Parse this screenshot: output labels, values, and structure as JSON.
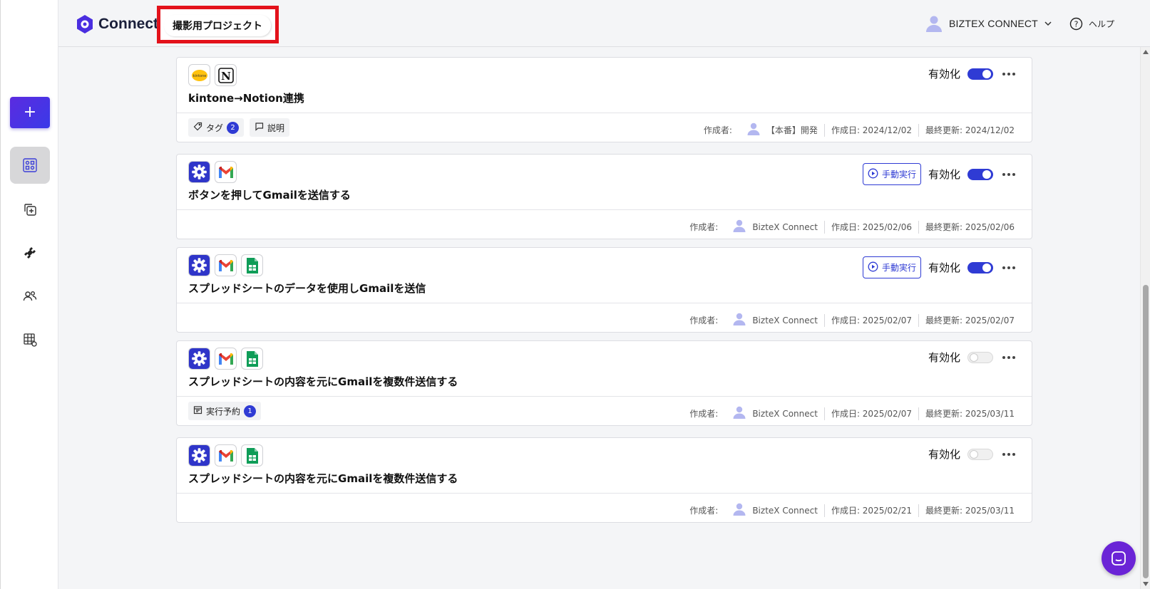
{
  "header": {
    "logo_text": "Connect",
    "project_name": "撮影用プロジェクト",
    "user_name": "BIZTEX CONNECT",
    "help_label": "ヘルプ"
  },
  "sidebar": {
    "add_label": "+"
  },
  "common": {
    "enable_label": "有効化",
    "manual_run_label": "手動実行",
    "author_label": "作成者:"
  },
  "flows": [
    {
      "title": "kintone→Notion連携",
      "apps": [
        "kintone-icon",
        "notion-icon"
      ],
      "enabled": true,
      "manual": false,
      "author": "【本番】開発",
      "created": "作成日: 2024/12/02",
      "updated": "最終更新: 2024/12/02",
      "chips": [
        {
          "label": "タグ",
          "icon": "tag-icon",
          "count": "2"
        },
        {
          "label": "説明",
          "icon": "comment-icon",
          "count": null
        }
      ]
    },
    {
      "title": "ボタンを押してGmailを送信する",
      "apps": [
        "gear-icon",
        "gmail-icon"
      ],
      "enabled": true,
      "manual": true,
      "author": "BizteX Connect",
      "created": "作成日: 2025/02/06",
      "updated": "最終更新: 2025/02/06",
      "chips": []
    },
    {
      "title": "スプレッドシートのデータを使用しGmailを送信",
      "apps": [
        "gear-icon",
        "gmail-icon",
        "sheets-icon"
      ],
      "enabled": true,
      "manual": true,
      "author": "BizteX Connect",
      "created": "作成日: 2025/02/07",
      "updated": "最終更新: 2025/02/07",
      "chips": []
    },
    {
      "title": "スプレッドシートの内容を元にGmailを複数件送信する",
      "apps": [
        "gear-icon",
        "gmail-icon",
        "sheets-icon"
      ],
      "enabled": false,
      "manual": false,
      "author": "BizteX Connect",
      "created": "作成日: 2025/02/07",
      "updated": "最終更新: 2025/03/11",
      "chips": [
        {
          "label": "実行予約",
          "icon": "calendar-icon",
          "count": "1"
        }
      ]
    },
    {
      "title": "スプレッドシートの内容を元にGmailを複数件送信する",
      "apps": [
        "gear-icon",
        "gmail-icon",
        "sheets-icon"
      ],
      "enabled": false,
      "manual": false,
      "author": "BizteX Connect",
      "created": "作成日: 2025/02/21",
      "updated": "最終更新: 2025/03/11",
      "chips": []
    }
  ],
  "colors": {
    "accent": "#2f3bd4",
    "highlight": "#e3121b",
    "chat": "#6a24d6"
  }
}
